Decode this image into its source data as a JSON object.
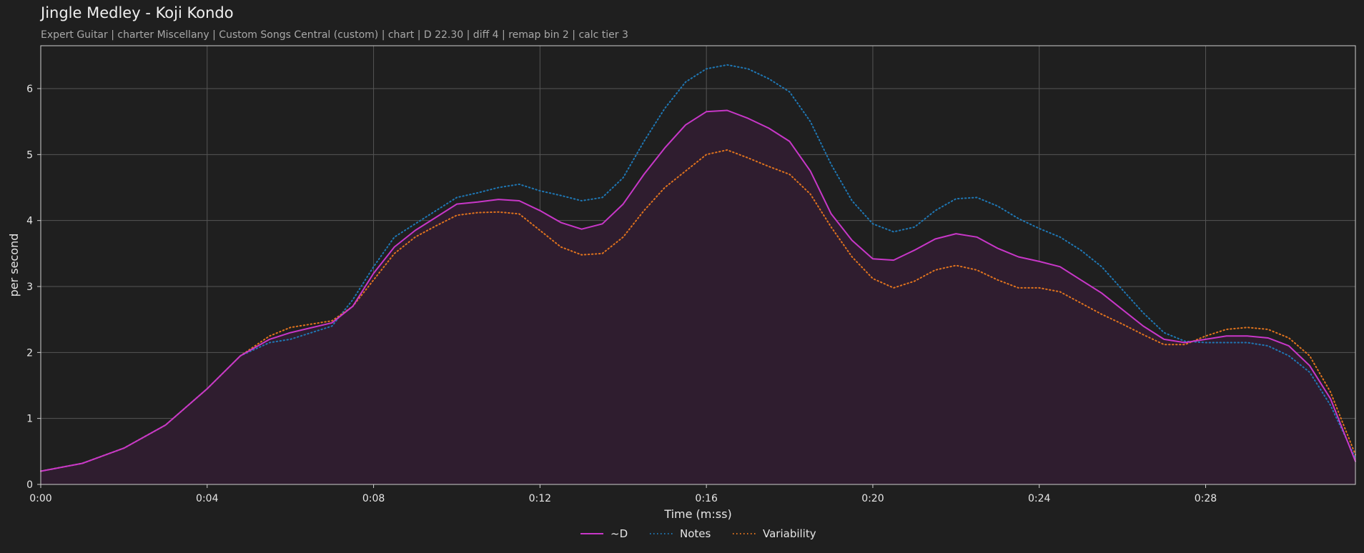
{
  "header": {
    "title": "Jingle Medley - Koji Kondo",
    "subtitle": "Expert Guitar  |  charter Miscellany  |  Custom Songs Central (custom)  |  chart  |  D 22.30  |  diff 4  |  remap bin 2  |  calc tier 3"
  },
  "colors": {
    "background": "#1f1f1f",
    "d_line": "#c837c8",
    "d_fill": "#2f1d2f",
    "notes": "#1f77b4",
    "variability": "#e0731e",
    "grid": "#555555"
  },
  "chart_data": {
    "type": "line",
    "title": "Jingle Medley - Koji Kondo",
    "xlabel": "Time (m:ss)",
    "ylabel": "per second",
    "xlim": [
      0,
      31.6
    ],
    "ylim": [
      0,
      6.65
    ],
    "grid": true,
    "legend_position": "bottom-center",
    "x_ticks": [
      {
        "value": 0,
        "label": "0:00"
      },
      {
        "value": 4,
        "label": "0:04"
      },
      {
        "value": 8,
        "label": "0:08"
      },
      {
        "value": 12,
        "label": "0:12"
      },
      {
        "value": 16,
        "label": "0:16"
      },
      {
        "value": 20,
        "label": "0:20"
      },
      {
        "value": 24,
        "label": "0:24"
      },
      {
        "value": 28,
        "label": "0:28"
      }
    ],
    "y_ticks": [
      0,
      1,
      2,
      3,
      4,
      5,
      6
    ],
    "series": [
      {
        "name": "~D",
        "style": "solid",
        "filled": true,
        "points": [
          [
            0,
            0.2
          ],
          [
            1,
            0.32
          ],
          [
            2,
            0.55
          ],
          [
            3,
            0.9
          ],
          [
            4,
            1.45
          ],
          [
            4.8,
            1.95
          ],
          [
            5.5,
            2.2
          ],
          [
            6,
            2.3
          ],
          [
            7,
            2.45
          ],
          [
            7.5,
            2.7
          ],
          [
            8,
            3.2
          ],
          [
            8.5,
            3.6
          ],
          [
            9,
            3.85
          ],
          [
            9.5,
            4.05
          ],
          [
            10,
            4.25
          ],
          [
            10.5,
            4.28
          ],
          [
            11,
            4.32
          ],
          [
            11.5,
            4.3
          ],
          [
            12,
            4.15
          ],
          [
            12.5,
            3.97
          ],
          [
            13,
            3.87
          ],
          [
            13.5,
            3.95
          ],
          [
            14,
            4.25
          ],
          [
            14.5,
            4.7
          ],
          [
            15,
            5.1
          ],
          [
            15.5,
            5.45
          ],
          [
            16,
            5.65
          ],
          [
            16.5,
            5.67
          ],
          [
            17,
            5.55
          ],
          [
            17.5,
            5.4
          ],
          [
            18,
            5.2
          ],
          [
            18.5,
            4.75
          ],
          [
            19,
            4.1
          ],
          [
            19.5,
            3.7
          ],
          [
            20,
            3.42
          ],
          [
            20.5,
            3.4
          ],
          [
            21,
            3.55
          ],
          [
            21.5,
            3.72
          ],
          [
            22,
            3.8
          ],
          [
            22.5,
            3.75
          ],
          [
            23,
            3.58
          ],
          [
            23.5,
            3.45
          ],
          [
            24,
            3.38
          ],
          [
            24.5,
            3.3
          ],
          [
            25,
            3.1
          ],
          [
            25.5,
            2.9
          ],
          [
            26,
            2.65
          ],
          [
            26.5,
            2.4
          ],
          [
            27,
            2.2
          ],
          [
            27.5,
            2.15
          ],
          [
            28,
            2.2
          ],
          [
            28.5,
            2.25
          ],
          [
            29,
            2.25
          ],
          [
            29.5,
            2.22
          ],
          [
            30,
            2.1
          ],
          [
            30.5,
            1.8
          ],
          [
            31,
            1.3
          ],
          [
            31.6,
            0.35
          ]
        ]
      },
      {
        "name": "Notes",
        "style": "dotted",
        "filled": false,
        "points": [
          [
            0,
            0.2
          ],
          [
            1,
            0.32
          ],
          [
            2,
            0.55
          ],
          [
            3,
            0.9
          ],
          [
            4,
            1.45
          ],
          [
            4.8,
            1.95
          ],
          [
            5.5,
            2.15
          ],
          [
            6,
            2.2
          ],
          [
            7,
            2.4
          ],
          [
            7.5,
            2.8
          ],
          [
            8,
            3.3
          ],
          [
            8.5,
            3.75
          ],
          [
            9,
            3.95
          ],
          [
            9.5,
            4.15
          ],
          [
            10,
            4.35
          ],
          [
            10.5,
            4.42
          ],
          [
            11,
            4.5
          ],
          [
            11.5,
            4.55
          ],
          [
            12,
            4.45
          ],
          [
            12.5,
            4.38
          ],
          [
            13,
            4.3
          ],
          [
            13.5,
            4.35
          ],
          [
            14,
            4.65
          ],
          [
            14.5,
            5.2
          ],
          [
            15,
            5.7
          ],
          [
            15.5,
            6.1
          ],
          [
            16,
            6.3
          ],
          [
            16.5,
            6.36
          ],
          [
            17,
            6.3
          ],
          [
            17.5,
            6.15
          ],
          [
            18,
            5.95
          ],
          [
            18.5,
            5.5
          ],
          [
            19,
            4.85
          ],
          [
            19.5,
            4.3
          ],
          [
            20,
            3.95
          ],
          [
            20.5,
            3.83
          ],
          [
            21,
            3.9
          ],
          [
            21.5,
            4.15
          ],
          [
            22,
            4.33
          ],
          [
            22.5,
            4.35
          ],
          [
            23,
            4.22
          ],
          [
            23.5,
            4.03
          ],
          [
            24,
            3.88
          ],
          [
            24.5,
            3.75
          ],
          [
            25,
            3.55
          ],
          [
            25.5,
            3.3
          ],
          [
            26,
            2.95
          ],
          [
            26.5,
            2.6
          ],
          [
            27,
            2.3
          ],
          [
            27.5,
            2.17
          ],
          [
            28,
            2.15
          ],
          [
            28.5,
            2.15
          ],
          [
            29,
            2.15
          ],
          [
            29.5,
            2.1
          ],
          [
            30,
            1.95
          ],
          [
            30.5,
            1.7
          ],
          [
            31,
            1.2
          ],
          [
            31.6,
            0.4
          ]
        ]
      },
      {
        "name": "Variability",
        "style": "dotted",
        "filled": false,
        "points": [
          [
            0,
            0.2
          ],
          [
            1,
            0.32
          ],
          [
            2,
            0.55
          ],
          [
            3,
            0.9
          ],
          [
            4,
            1.45
          ],
          [
            4.8,
            1.95
          ],
          [
            5.5,
            2.25
          ],
          [
            6,
            2.38
          ],
          [
            7,
            2.48
          ],
          [
            7.5,
            2.7
          ],
          [
            8,
            3.1
          ],
          [
            8.5,
            3.5
          ],
          [
            9,
            3.75
          ],
          [
            9.5,
            3.92
          ],
          [
            10,
            4.08
          ],
          [
            10.5,
            4.12
          ],
          [
            11,
            4.13
          ],
          [
            11.5,
            4.1
          ],
          [
            12,
            3.85
          ],
          [
            12.5,
            3.6
          ],
          [
            13,
            3.48
          ],
          [
            13.5,
            3.5
          ],
          [
            14,
            3.75
          ],
          [
            14.5,
            4.15
          ],
          [
            15,
            4.5
          ],
          [
            15.5,
            4.75
          ],
          [
            16,
            5.0
          ],
          [
            16.5,
            5.07
          ],
          [
            17,
            4.95
          ],
          [
            17.5,
            4.82
          ],
          [
            18,
            4.7
          ],
          [
            18.5,
            4.4
          ],
          [
            19,
            3.9
          ],
          [
            19.5,
            3.45
          ],
          [
            20,
            3.12
          ],
          [
            20.5,
            2.98
          ],
          [
            21,
            3.08
          ],
          [
            21.5,
            3.25
          ],
          [
            22,
            3.32
          ],
          [
            22.5,
            3.25
          ],
          [
            23,
            3.1
          ],
          [
            23.5,
            2.98
          ],
          [
            24,
            2.98
          ],
          [
            24.5,
            2.92
          ],
          [
            25,
            2.75
          ],
          [
            25.5,
            2.58
          ],
          [
            26,
            2.43
          ],
          [
            26.5,
            2.27
          ],
          [
            27,
            2.12
          ],
          [
            27.5,
            2.12
          ],
          [
            28,
            2.25
          ],
          [
            28.5,
            2.35
          ],
          [
            29,
            2.38
          ],
          [
            29.5,
            2.35
          ],
          [
            30,
            2.22
          ],
          [
            30.5,
            1.95
          ],
          [
            31,
            1.4
          ],
          [
            31.6,
            0.45
          ]
        ]
      }
    ]
  }
}
